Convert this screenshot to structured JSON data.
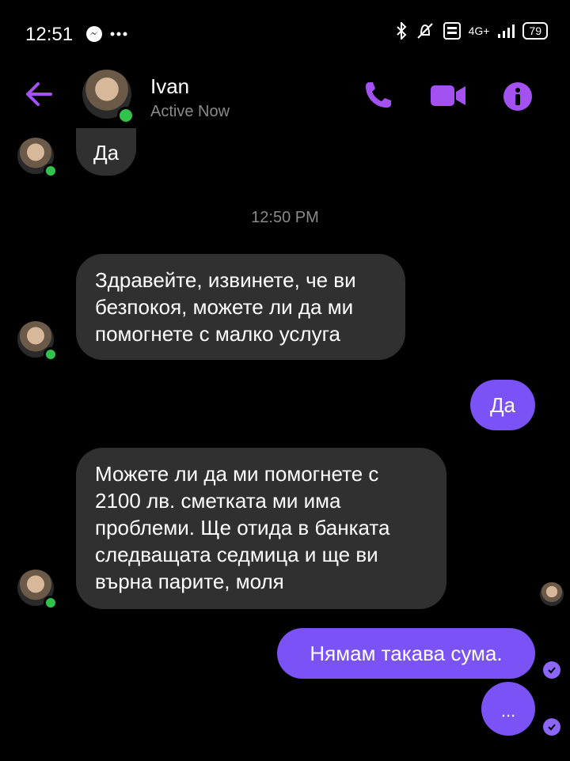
{
  "status_bar": {
    "time": "12:51",
    "notification_icons": [
      "messenger-icon",
      "more-dots-icon"
    ],
    "network": "4G+",
    "battery": "79"
  },
  "header": {
    "contact_name": "Ivan",
    "presence": "Active Now",
    "icons": [
      "back-arrow-icon",
      "phone-icon",
      "video-icon",
      "info-icon"
    ],
    "accent_color": "#a351f0"
  },
  "messages": [
    {
      "from": "contact",
      "text": "Да"
    },
    {
      "type": "timestamp",
      "text": "12:50 PM"
    },
    {
      "from": "contact",
      "text": "Здравейте, извинете, че ви безпокоя, можете ли да ми помогнете с малко услуга"
    },
    {
      "from": "me",
      "text": "Да"
    },
    {
      "from": "contact",
      "text": "Можете ли да ми помогнете с 2100 лв. сметката ми има проблеми. Ще отида в банката следващата седмица и ще ви върна парите, моля"
    },
    {
      "from": "me",
      "text": "Нямам такава сума."
    },
    {
      "from": "me",
      "text": "..."
    }
  ],
  "colors": {
    "incoming_bubble": "#303030",
    "outgoing_bubble": "#7b52f5",
    "online": "#31c24d"
  }
}
